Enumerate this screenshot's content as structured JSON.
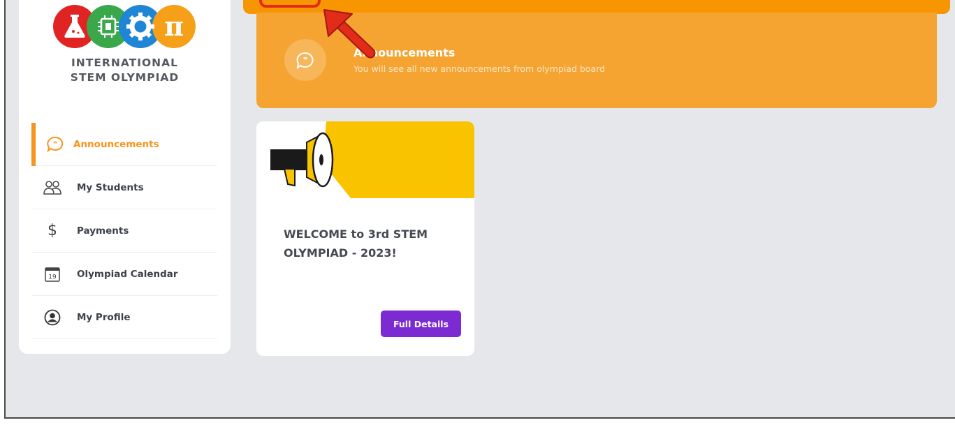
{
  "brand": {
    "line1": "INTERNATIONAL",
    "line2": "STEM OLYMPIAD",
    "pi_symbol": "π",
    "logo_icons": [
      "flask-icon",
      "circuit-chip-icon",
      "gear-icon",
      "pi-icon"
    ],
    "logo_colors": [
      "#e02424",
      "#3aa84a",
      "#1f86d6",
      "#f6a01a"
    ]
  },
  "sidebar": {
    "items": [
      {
        "label": "Announcements",
        "icon": "speech-bubble-icon",
        "active": true
      },
      {
        "label": "My Students",
        "icon": "users-icon",
        "active": false
      },
      {
        "label": "Payments",
        "icon": "dollar-icon",
        "active": false
      },
      {
        "label": "Olympiad Calendar",
        "icon": "calendar-icon",
        "active": false,
        "icon_text": "19"
      },
      {
        "label": "My Profile",
        "icon": "user-circle-icon",
        "active": false
      }
    ]
  },
  "banner": {
    "title": "Announcements",
    "subtitle": "You will see all new announcements from olympiad board",
    "icon": "speech-bubble-icon"
  },
  "cards": [
    {
      "title": "WELCOME to 3rd STEM OLYMPIAD - 2023!",
      "button_label": "Full Details",
      "image_icon": "megaphone-icon"
    }
  ],
  "colors": {
    "accent": "#f7941d",
    "banner": "#f5a431",
    "topbar": "#f79600",
    "button": "#7b2bd1",
    "annotation": "#e32b1a",
    "card_image": "#f9c300"
  }
}
